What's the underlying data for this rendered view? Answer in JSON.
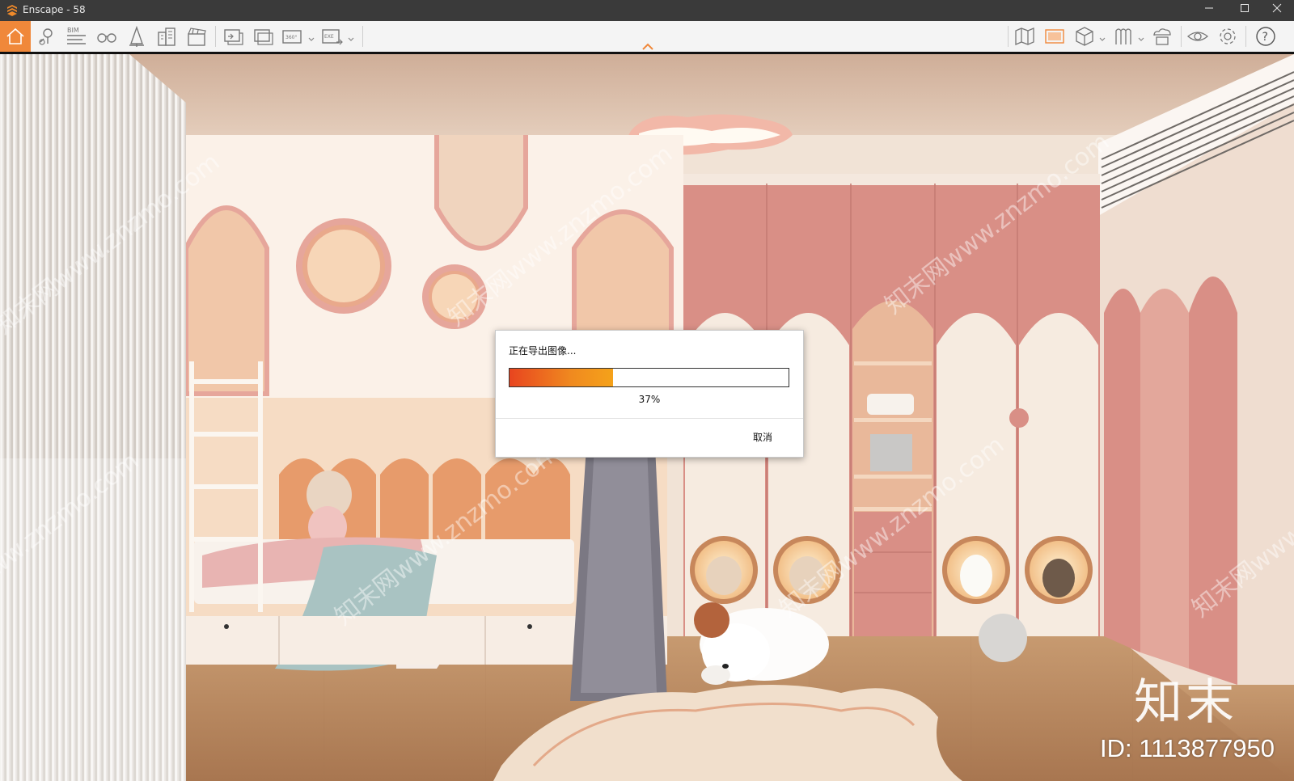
{
  "window": {
    "title": "Enscape - 58",
    "app_icon": "enscape-logo-icon",
    "controls": [
      "minimize-icon",
      "maximize-icon",
      "close-icon"
    ]
  },
  "toolbar": {
    "left_buttons": [
      {
        "name": "home-icon",
        "active": true
      },
      {
        "name": "pin-location-icon"
      },
      {
        "name": "bim-icon",
        "label": "BIM"
      },
      {
        "name": "binoculars-icon"
      },
      {
        "name": "nature-icon"
      },
      {
        "name": "buildings-icon"
      },
      {
        "name": "clapperboard-icon"
      },
      {
        "name": "screenshot-export-icon"
      },
      {
        "name": "batch-render-icon"
      },
      {
        "name": "panorama-360-icon",
        "label": "360°"
      },
      {
        "name": "export-exe-icon",
        "label": "EXE"
      }
    ],
    "right_buttons": [
      {
        "name": "map-icon"
      },
      {
        "name": "image-view-icon"
      },
      {
        "name": "cube-icon"
      },
      {
        "name": "asset-library-icon"
      },
      {
        "name": "upload-cloud-icon"
      },
      {
        "name": "eye-icon"
      },
      {
        "name": "settings-gear-icon"
      },
      {
        "name": "help-icon",
        "label": "?"
      }
    ],
    "accent_color": "#f0883a"
  },
  "dialog": {
    "title": "正在导出图像...",
    "progress": 0.37,
    "progress_label": "37%",
    "cancel_label": "取消"
  },
  "watermark": {
    "repeat_text": "知末网www.znzmo.com",
    "logo_text": "知末",
    "id_text": "ID: 1113877950"
  }
}
